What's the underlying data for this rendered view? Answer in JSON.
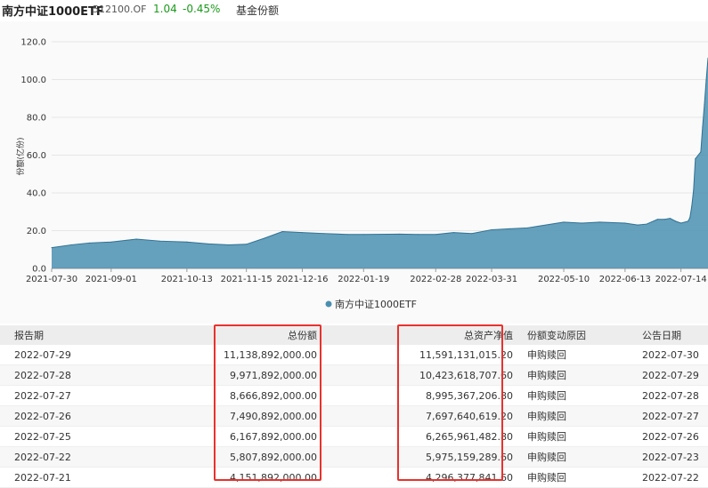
{
  "header": {
    "fund_name": "南方中证1000ETF",
    "code": "512100.OF",
    "price": "1.04",
    "change": "-0.45%",
    "tab": "基金份额",
    "colors": {
      "up": "#1a9a1a",
      "neg": "#1a9a1a"
    }
  },
  "chart_data": {
    "type": "area",
    "ylabel": "份额(亿份)",
    "ylim": [
      0,
      120
    ],
    "yticks": [
      "120.0",
      "100.0",
      "80.0",
      "60.0",
      "40.0",
      "20.0",
      "0.0"
    ],
    "xticks": [
      "2021-07-30",
      "2021-09-01",
      "2021-10-13",
      "2021-11-15",
      "2021-12-16",
      "2022-01-19",
      "2022-02-28",
      "2022-03-31",
      "2022-05-10",
      "2022-06-13",
      "2022-07-14"
    ],
    "grid": true,
    "legend_position": "bottom",
    "series": [
      {
        "name": "南方中证1000ETF",
        "color": "#4a8fb0",
        "x": [
          "2021-07-30",
          "2021-08-10",
          "2021-08-20",
          "2021-09-01",
          "2021-09-15",
          "2021-09-28",
          "2021-10-13",
          "2021-10-25",
          "2021-11-05",
          "2021-11-15",
          "2021-11-25",
          "2021-12-05",
          "2021-12-16",
          "2021-12-28",
          "2022-01-10",
          "2022-01-19",
          "2022-02-08",
          "2022-02-18",
          "2022-02-28",
          "2022-03-10",
          "2022-03-20",
          "2022-03-31",
          "2022-04-10",
          "2022-04-20",
          "2022-05-10",
          "2022-05-20",
          "2022-05-30",
          "2022-06-13",
          "2022-06-20",
          "2022-06-25",
          "2022-07-01",
          "2022-07-05",
          "2022-07-08",
          "2022-07-11",
          "2022-07-14",
          "2022-07-18",
          "2022-07-19",
          "2022-07-20",
          "2022-07-21",
          "2022-07-22",
          "2022-07-25",
          "2022-07-26",
          "2022-07-27",
          "2022-07-28",
          "2022-07-29"
        ],
        "values": [
          11.0,
          12.5,
          13.5,
          14.0,
          15.5,
          14.5,
          14.0,
          13.0,
          12.5,
          12.8,
          16.0,
          19.5,
          19.0,
          18.5,
          18.0,
          18.0,
          18.2,
          18.0,
          18.0,
          19.0,
          18.5,
          20.5,
          21.0,
          21.5,
          24.5,
          24.0,
          24.5,
          24.0,
          23.0,
          23.5,
          26.0,
          26.0,
          26.5,
          25.0,
          24.0,
          25.0,
          27.0,
          33.0,
          41.5,
          58.1,
          61.7,
          74.9,
          86.7,
          99.7,
          111.4
        ]
      }
    ]
  },
  "table": {
    "headers": [
      "报告期",
      "总份额",
      "总资产净值",
      "份额变动原因",
      "公告日期"
    ],
    "rows": [
      [
        "2022-07-29",
        "11,138,892,000.00",
        "11,591,131,015.20",
        "申购赎回",
        "2022-07-30"
      ],
      [
        "2022-07-28",
        "9,971,892,000.00",
        "10,423,618,707.60",
        "申购赎回",
        "2022-07-29"
      ],
      [
        "2022-07-27",
        "8,666,892,000.00",
        "8,995,367,206.80",
        "申购赎回",
        "2022-07-28"
      ],
      [
        "2022-07-26",
        "7,490,892,000.00",
        "7,697,640,619.20",
        "申购赎回",
        "2022-07-27"
      ],
      [
        "2022-07-25",
        "6,167,892,000.00",
        "6,265,961,482.80",
        "申购赎回",
        "2022-07-26"
      ],
      [
        "2022-07-22",
        "5,807,892,000.00",
        "5,975,159,289.60",
        "申购赎回",
        "2022-07-23"
      ],
      [
        "2022-07-21",
        "4,151,892,000.00",
        "4,296,377,841.60",
        "申购赎回",
        "2022-07-22"
      ]
    ],
    "highlight_color": "#e8322d"
  }
}
